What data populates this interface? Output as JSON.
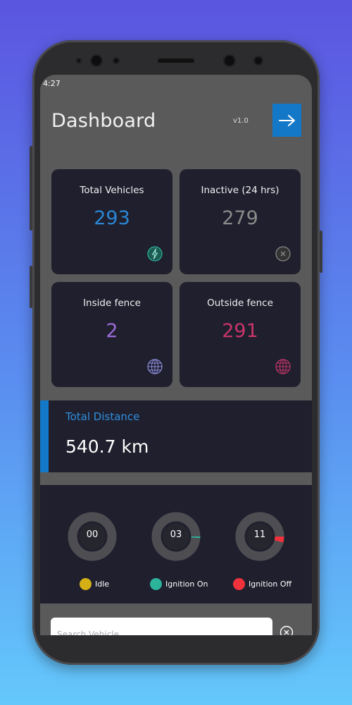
{
  "status_bar": {
    "time": "4:27"
  },
  "header": {
    "title": "Dashboard",
    "version": "v1.0",
    "logout_icon": "arrow-right-icon"
  },
  "cards": [
    {
      "label": "Total Vehicles",
      "value": "293",
      "color": "#2a86d4",
      "icon": "bolt-icon",
      "icon_color": "#2bb39b"
    },
    {
      "label": "Inactive (24 hrs)",
      "value": "279",
      "color": "#8a8a8a",
      "icon": "close-circle-icon",
      "icon_color": "#8a8a8a"
    },
    {
      "label": "Inside fence",
      "value": "2",
      "color": "#9c6bd8",
      "icon": "globe-icon",
      "icon_color": "#8f8fe0"
    },
    {
      "label": "Outside fence",
      "value": "291",
      "color": "#c8356a",
      "icon": "globe-icon",
      "icon_color": "#c8356a"
    }
  ],
  "distance": {
    "label": "Total Distance",
    "value": "540.7 km",
    "accent": "#1478c8"
  },
  "gauges": [
    {
      "value": "00",
      "fraction": 0,
      "color": "#d4b016"
    },
    {
      "value": "03",
      "fraction": 0.01,
      "color": "#2bb39b"
    },
    {
      "value": "11",
      "fraction": 0.04,
      "color": "#f0323c"
    }
  ],
  "legend": [
    {
      "label": "Idle",
      "color": "#d4b016"
    },
    {
      "label": "Ignition On",
      "color": "#2bb39b"
    },
    {
      "label": "Ignition Off",
      "color": "#f0323c"
    }
  ],
  "search": {
    "placeholder": "Search Vehicle",
    "value": "",
    "clear_icon": "close-circle-icon"
  }
}
